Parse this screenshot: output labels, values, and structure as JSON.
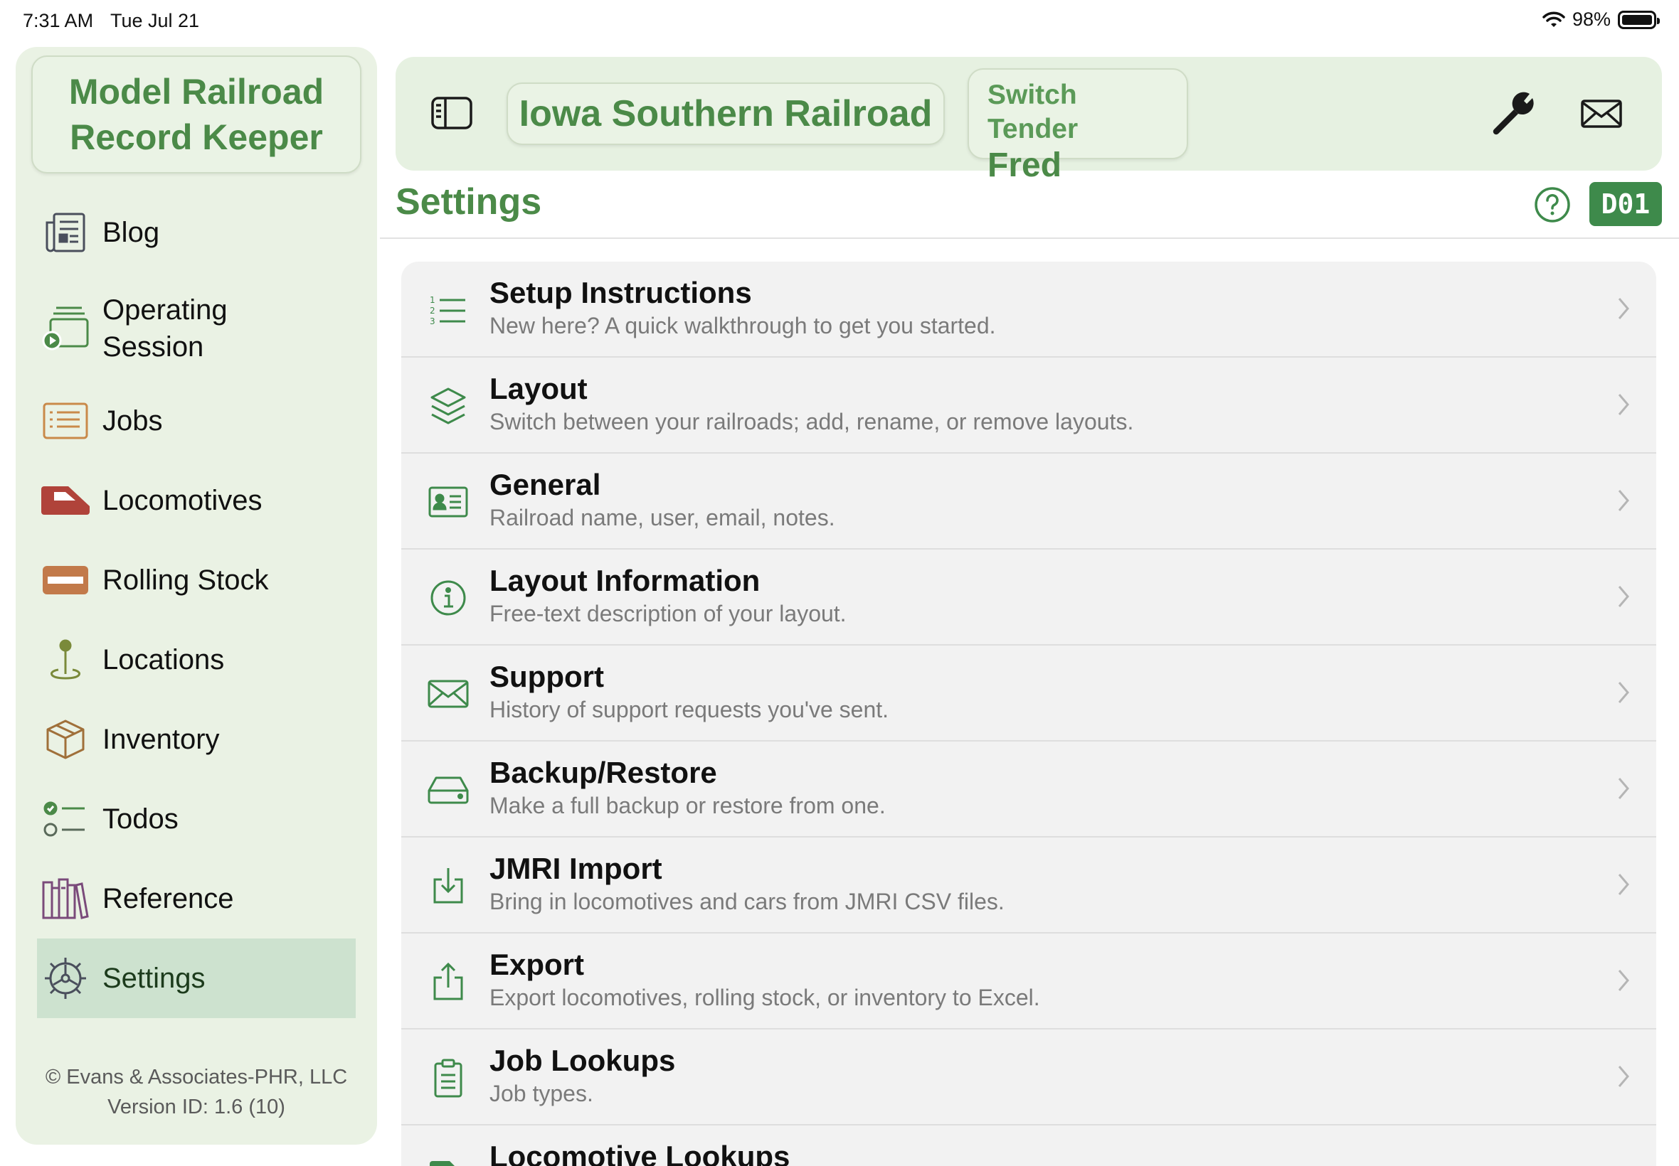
{
  "status_bar": {
    "time": "7:31 AM",
    "date": "Tue Jul 21",
    "battery": "98%"
  },
  "sidebar": {
    "app_title": "Model Railroad\nRecord Keeper",
    "items": [
      {
        "label": "Blog",
        "icon": "newspaper-icon",
        "color": "#4a4f5c"
      },
      {
        "label": "Operating\nSession",
        "icon": "operating-session-icon",
        "color": "#4b8a48"
      },
      {
        "label": "Jobs",
        "icon": "list-icon",
        "color": "#c98a4a"
      },
      {
        "label": "Locomotives",
        "icon": "locomotive-icon",
        "color": "#b0433a"
      },
      {
        "label": "Rolling Stock",
        "icon": "rolling-stock-icon",
        "color": "#c27a4a"
      },
      {
        "label": "Locations",
        "icon": "map-pin-icon",
        "color": "#7a8a3a"
      },
      {
        "label": "Inventory",
        "icon": "box-icon",
        "color": "#a0703a"
      },
      {
        "label": "Todos",
        "icon": "checklist-icon",
        "color": "#4b8a48"
      },
      {
        "label": "Reference",
        "icon": "books-icon",
        "color": "#7a4a7a"
      },
      {
        "label": "Settings",
        "icon": "gear-icon",
        "color": "#4a4f5c",
        "active": true
      }
    ],
    "footer": {
      "copyright": "© Evans & Associates-PHR, LLC",
      "version": "Version ID: 1.6 (10)"
    }
  },
  "header": {
    "railroad": "Iowa Southern Railroad",
    "role": "Switch Tender",
    "user": "Fred"
  },
  "page": {
    "title": "Settings",
    "badge": "D01"
  },
  "settings": [
    {
      "title": "Setup Instructions",
      "subtitle": "New here? A quick walkthrough to get you started.",
      "icon": "numbered-list-icon"
    },
    {
      "title": "Layout",
      "subtitle": "Switch between your railroads; add, rename, or remove layouts.",
      "icon": "layers-icon"
    },
    {
      "title": "General",
      "subtitle": "Railroad name, user, email, notes.",
      "icon": "contact-card-icon"
    },
    {
      "title": "Layout Information",
      "subtitle": "Free-text description of your layout.",
      "icon": "info-icon"
    },
    {
      "title": "Support",
      "subtitle": "History of support requests you've sent.",
      "icon": "envelope-icon"
    },
    {
      "title": "Backup/Restore",
      "subtitle": "Make a full backup or restore from one.",
      "icon": "drive-icon"
    },
    {
      "title": "JMRI Import",
      "subtitle": "Bring in locomotives and cars from JMRI CSV files.",
      "icon": "import-icon"
    },
    {
      "title": "Export",
      "subtitle": "Export locomotives, rolling stock, or inventory to Excel.",
      "icon": "export-icon"
    },
    {
      "title": "Job Lookups",
      "subtitle": "Job types.",
      "icon": "clipboard-icon"
    },
    {
      "title": "Locomotive Lookups",
      "subtitle": "",
      "icon": "locomotive-icon"
    }
  ],
  "colors": {
    "accent": "#4b8a48",
    "sidebar_bg": "#eaf2e4",
    "selected_bg": "#cde2cf",
    "badge_bg": "#3e8a4b"
  }
}
